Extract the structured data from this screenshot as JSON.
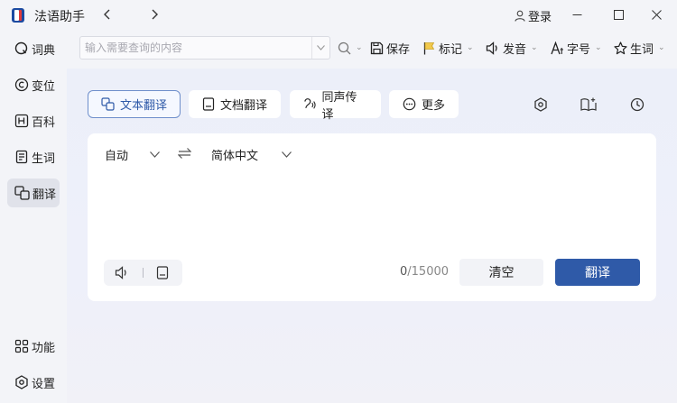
{
  "app": {
    "title": "法语助手",
    "login_label": "登录",
    "accent_color": "#2f5aa8"
  },
  "sidebar": {
    "items": [
      {
        "label": "词典",
        "icon": "search-icon"
      },
      {
        "label": "变位",
        "icon": "copyright-icon"
      },
      {
        "label": "百科",
        "icon": "encyclopedia-icon"
      },
      {
        "label": "生词",
        "icon": "notes-icon"
      },
      {
        "label": "翻译",
        "icon": "translate-icon",
        "active": true
      }
    ],
    "bottom": [
      {
        "label": "功能",
        "icon": "grid-icon"
      },
      {
        "label": "设置",
        "icon": "gear-icon"
      }
    ]
  },
  "toolbar": {
    "search_placeholder": "输入需要查询的内容",
    "save_label": "保存",
    "mark_label": "标记",
    "voice_label": "发音",
    "font_label": "字号",
    "vocab_label": "生词"
  },
  "tabs": [
    {
      "label": "文本翻译",
      "icon": "text-translate-icon",
      "active": true
    },
    {
      "label": "文档翻译",
      "icon": "document-icon"
    },
    {
      "label": "同声传译",
      "icon": "interpret-icon"
    },
    {
      "label": "更多",
      "icon": "more-icon"
    }
  ],
  "translator": {
    "source_lang": "自动",
    "target_lang": "简体中文",
    "char_count": "0",
    "char_limit": "/15000",
    "clear_label": "清空",
    "translate_label": "翻译"
  }
}
